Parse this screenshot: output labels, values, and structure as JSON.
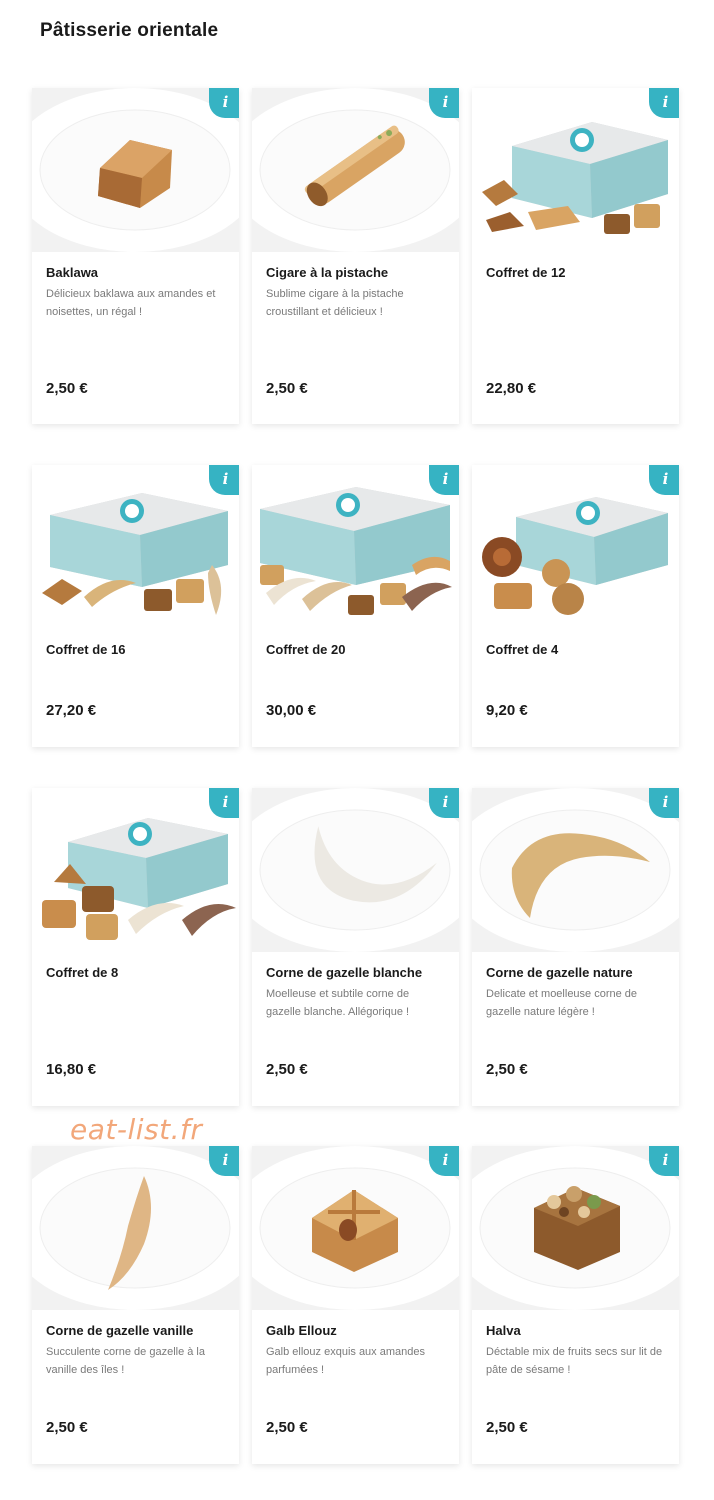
{
  "page": {
    "section_title": "Pâtisserie orientale",
    "watermark": "eat-list.fr"
  },
  "colors": {
    "info_badge": "#36b3c3",
    "price_text": "#1a1a1a",
    "description_text": "#7a7a7a",
    "box_pattern": "#7fc8cc",
    "watermark": "#f2a77a"
  },
  "info_icon_glyph": "i",
  "products": [
    {
      "name": "Baklawa",
      "description": "Délicieux baklawa aux amandes et noisettes, un régal !",
      "price": "2,50 €",
      "image": "baklawa-on-plate"
    },
    {
      "name": "Cigare à la pistache",
      "description": "Sublime cigare à la pistache croustillant et délicieux !",
      "price": "2,50 €",
      "image": "cigar-pastry-on-plate"
    },
    {
      "name": "Coffret de 12",
      "description": "",
      "price": "22,80 €",
      "image": "gift-box-with-pastries"
    },
    {
      "name": "Coffret de 16",
      "description": "",
      "price": "27,20 €",
      "image": "gift-box-with-pastries"
    },
    {
      "name": "Coffret de 20",
      "description": "",
      "price": "30,00 €",
      "image": "gift-box-with-pastries"
    },
    {
      "name": "Coffret de 4",
      "description": "",
      "price": "9,20 €",
      "image": "gift-box-with-pastries"
    },
    {
      "name": "Coffret de 8",
      "description": "",
      "price": "16,80 €",
      "image": "gift-box-with-pastries"
    },
    {
      "name": "Corne de gazelle blanche",
      "description": "Moelleuse et subtile corne de gazelle blanche. Allégorique !",
      "price": "2,50 €",
      "image": "white-crescent-on-plate"
    },
    {
      "name": "Corne de gazelle nature",
      "description": "Delicate et moelleuse corne de gazelle nature légère !",
      "price": "2,50 €",
      "image": "golden-crescent-on-plate"
    },
    {
      "name": "Corne de gazelle vanille",
      "description": "Succulente corne de gazelle à la vanille des îles !",
      "price": "2,50 €",
      "image": "vanilla-crescent-on-plate"
    },
    {
      "name": "Galb Ellouz",
      "description": "Galb ellouz exquis aux amandes parfumées !",
      "price": "2,50 €",
      "image": "almond-pastry-on-plate"
    },
    {
      "name": "Halva",
      "description": "Déctable mix de fruits secs sur lit de pâte de sésame !",
      "price": "2,50 €",
      "image": "halva-on-plate"
    }
  ]
}
